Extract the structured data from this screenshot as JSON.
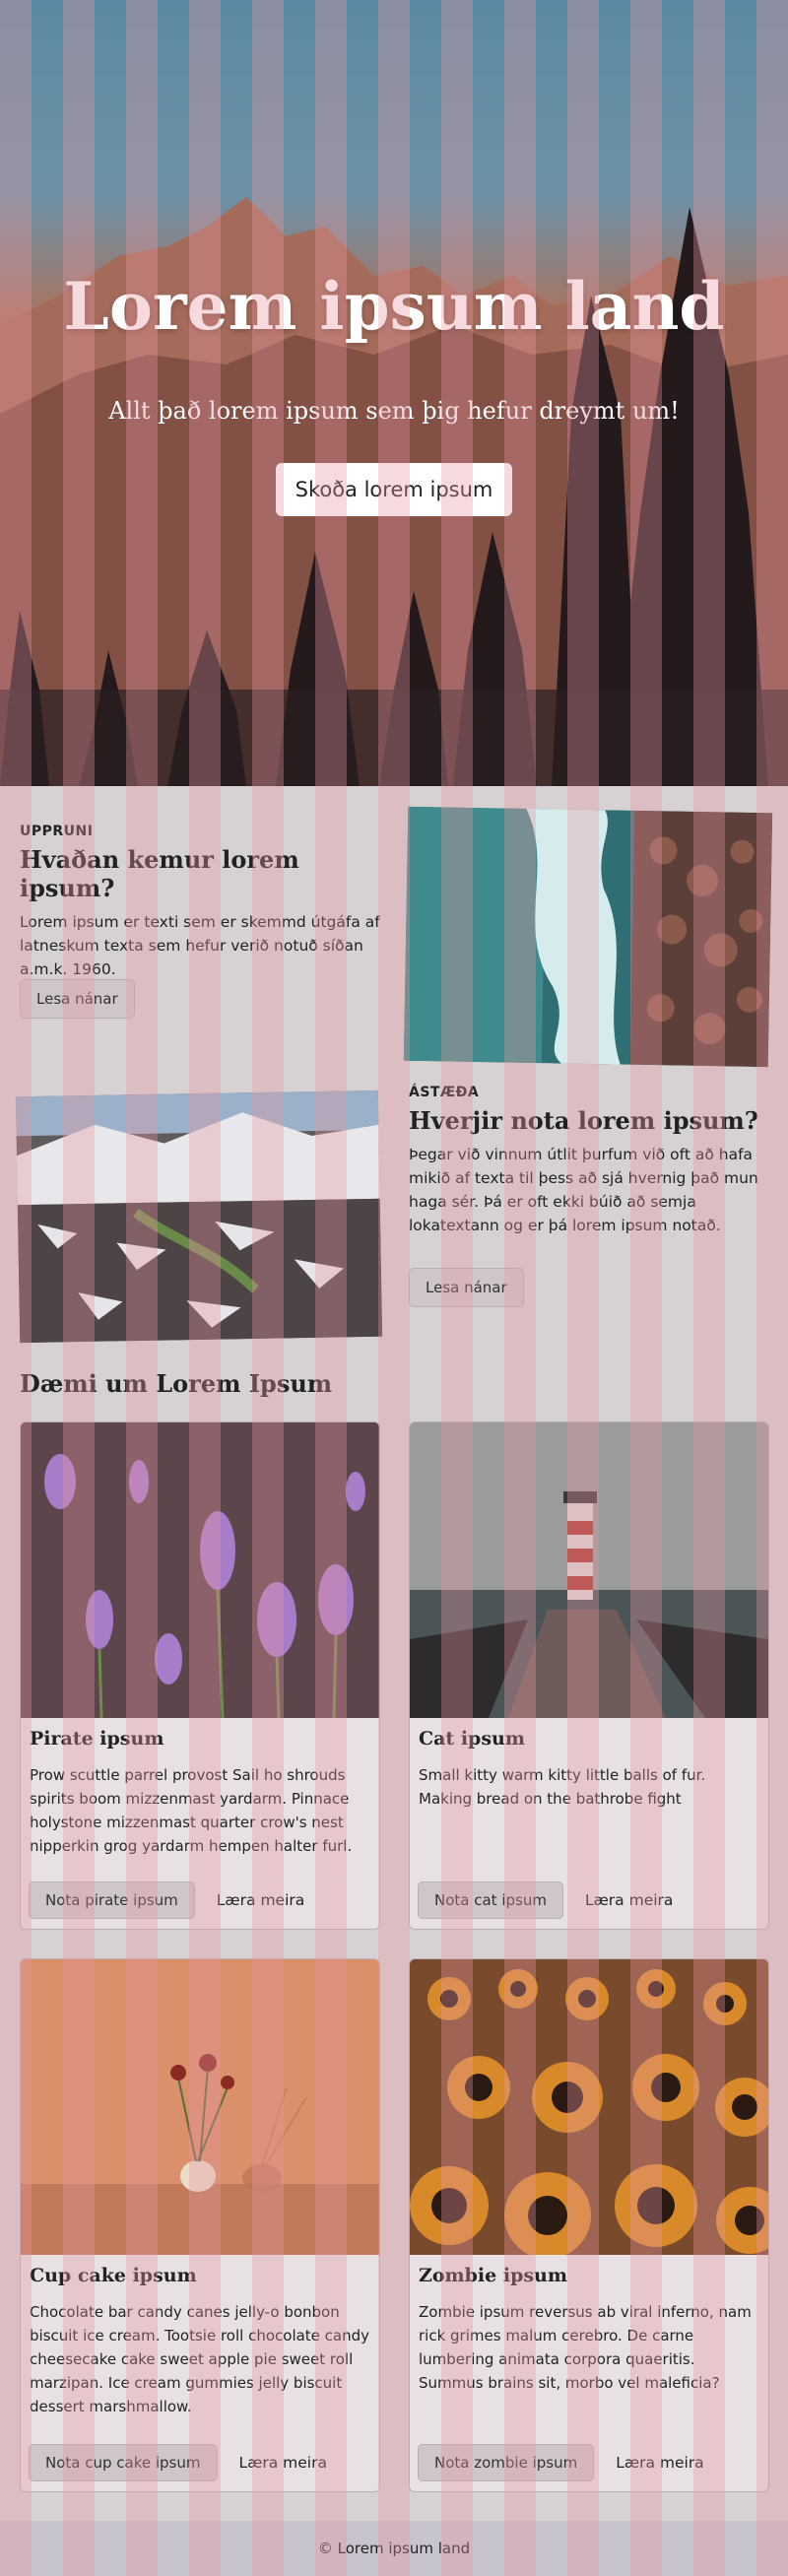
{
  "hero": {
    "title": "Lorem ipsum land",
    "subtitle": "Allt það lorem ipsum sem þig hefur dreymt um!",
    "button_label": "Skoða lorem ipsum"
  },
  "sections": [
    {
      "eyebrow": "UPPRUNI",
      "title": "Hvaðan kemur lorem ipsum?",
      "text": "Lorem ipsum er texti sem er skemmd útgáfa af latneskum texta sem hefur verið notuð síðan a.m.k. 1960.",
      "button_label": "Lesa nánar"
    },
    {
      "eyebrow": "ÁSTÆÐA",
      "title": "Hverjir nota lorem ipsum?",
      "text": "Þegar við vinnum útlit þurfum við oft að hafa mikið af texta til þess að sjá hvernig það mun haga sér. Þá er oft ekki búið að semja lokatextann og er þá lorem ipsum notað.",
      "button_label": "Lesa nánar"
    }
  ],
  "examples": {
    "title": "Dæmi um Lorem Ipsum",
    "cards": [
      {
        "title": "Pirate ipsum",
        "text": "Prow scuttle parrel provost Sail ho shrouds spirits boom mizzenmast yardarm. Pinnace holystone mizzenmast quarter crow's nest nipperkin grog yardarm hempen halter furl.",
        "primary_label": "Nota pirate ipsum",
        "secondary_label": "Læra meira"
      },
      {
        "title": "Cat ipsum",
        "text": "Small kitty warm kitty little balls of fur. Making bread on the bathrobe fight",
        "primary_label": "Nota cat ipsum",
        "secondary_label": "Læra meira"
      },
      {
        "title": "Cup cake ipsum",
        "text": "Chocolate bar candy canes jelly-o bonbon biscuit ice cream. Tootsie roll chocolate candy cheesecake cake sweet apple pie sweet roll marzipan. Ice cream gummies jelly biscuit dessert marshmallow.",
        "primary_label": "Nota cup cake ipsum",
        "secondary_label": "Læra meira"
      },
      {
        "title": "Zombie ipsum",
        "text": "Zombie ipsum reversus ab viral inferno, nam rick grimes malum cerebro. De carne lumbering animata corpora quaeritis. Summus brains sit, morbo vel maleficia?",
        "primary_label": "Nota zombie ipsum",
        "secondary_label": "Læra meira"
      }
    ]
  },
  "footer": {
    "text": "© Lorem ipsum land"
  }
}
